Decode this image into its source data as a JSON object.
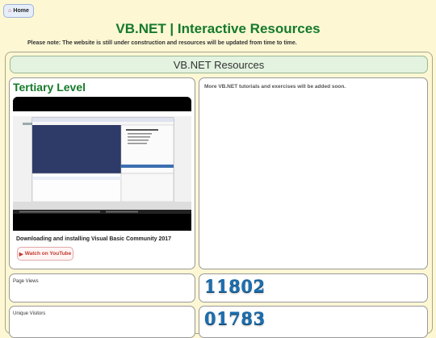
{
  "nav": {
    "home_label": "Home",
    "home_icon": "home-icon"
  },
  "header": {
    "title": "VB.NET | Interactive Resources",
    "note": "Please note: The website is still under construction and resources will be updated from time to time."
  },
  "resources": {
    "heading": "VB.NET Resources",
    "tertiary": {
      "title": "Tertiary Level",
      "video_caption": "Downloading and installing Visual Basic Community 2017",
      "watch_label": "Watch on YouTube",
      "watch_icon": "play-icon"
    },
    "more_note": "More VB.NET tutorials and exercises will be added soon."
  },
  "stats": {
    "page_views_label": "Page Views",
    "page_views_value": "11802",
    "unique_visitors_label": "Unique Visitors",
    "unique_visitors_value": "01783"
  },
  "colors": {
    "accent_green": "#157a2a",
    "counter_blue": "#1c6fb0",
    "background": "#fdf7d4"
  }
}
